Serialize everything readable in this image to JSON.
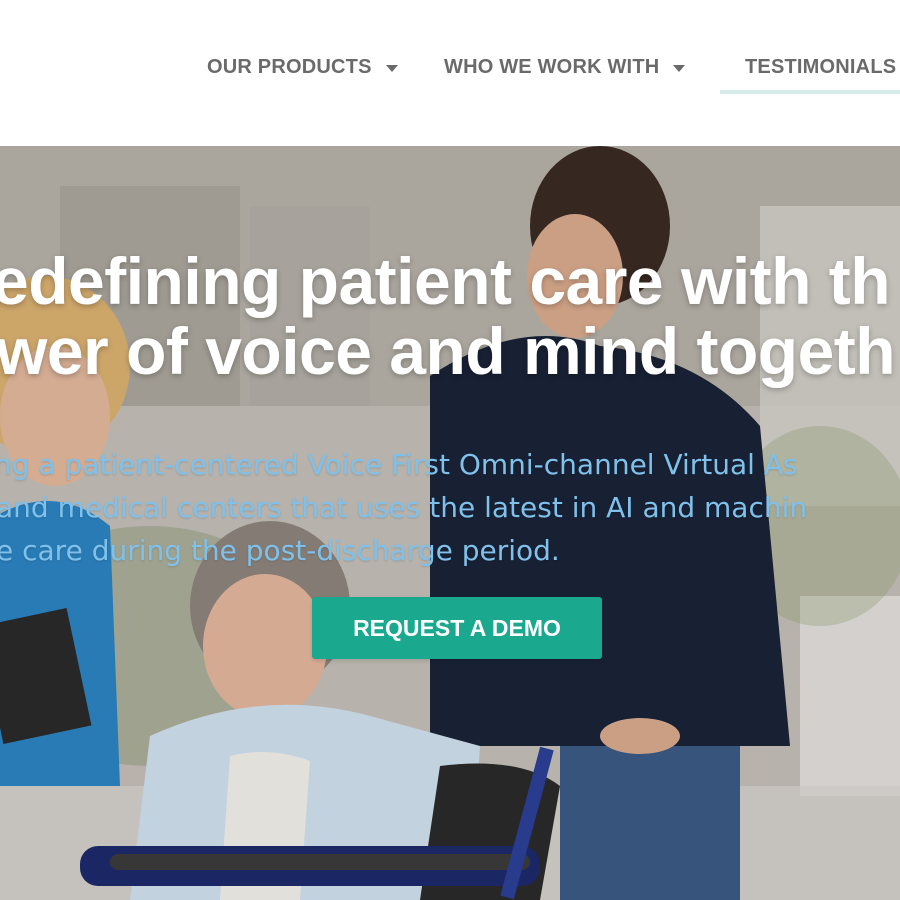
{
  "nav": {
    "items": [
      {
        "label": "OUR PRODUCTS",
        "icon": "chevron-down-icon"
      },
      {
        "label": "WHO WE WORK WITH",
        "icon": "chevron-down-icon"
      },
      {
        "label": "TESTIMONIALS"
      }
    ],
    "active_item": "TESTIMONIALS"
  },
  "hero": {
    "headline_line1": "edefining patient care with th",
    "headline_line2": "wer of voice and mind togeth",
    "subtext_line1": "ng a patient-centered Voice First Omni-channel Virtual As",
    "subtext_line2": "and medical centers that uses the latest in AI and machin",
    "subtext_line3": "e care during the post-discharge period.",
    "cta_label": "REQUEST A DEMO"
  },
  "colors": {
    "nav_text": "#6a6a6a",
    "nav_active_underline": "#d7ecea",
    "headline": "#ffffff",
    "subtext": "#7fc1ea",
    "cta_background": "#1aa98f",
    "cta_text": "#ffffff"
  }
}
